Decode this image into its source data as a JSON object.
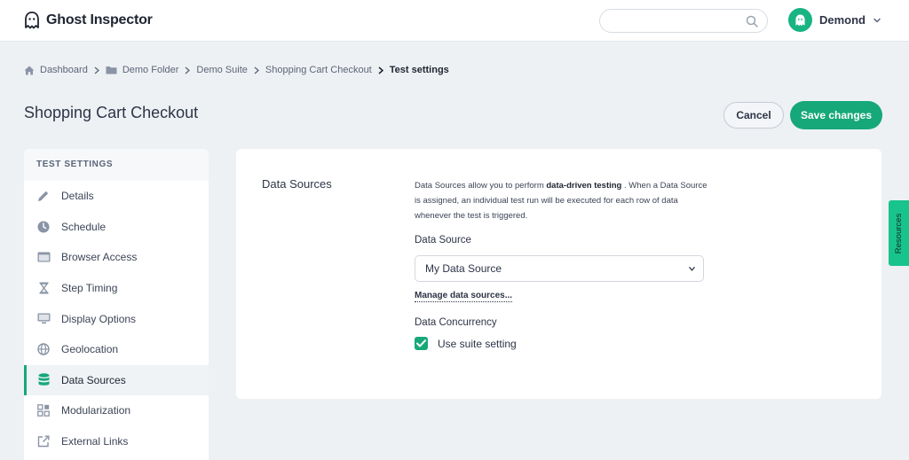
{
  "app": {
    "name": "Ghost Inspector"
  },
  "search": {
    "placeholder": "",
    "value": ""
  },
  "user": {
    "name": "Demond"
  },
  "breadcrumb": {
    "items": [
      "Dashboard",
      "Demo Folder",
      "Demo Suite",
      "Shopping Cart Checkout"
    ],
    "current": "Test settings"
  },
  "page": {
    "title": "Shopping Cart Checkout"
  },
  "actions": {
    "cancel": "Cancel",
    "save": "Save changes"
  },
  "sidebar": {
    "header": "TEST SETTINGS",
    "items": [
      {
        "label": "Details",
        "icon": "pencil-icon"
      },
      {
        "label": "Schedule",
        "icon": "clock-icon"
      },
      {
        "label": "Browser Access",
        "icon": "browser-window-icon"
      },
      {
        "label": "Step Timing",
        "icon": "hourglass-icon"
      },
      {
        "label": "Display Options",
        "icon": "monitor-icon"
      },
      {
        "label": "Geolocation",
        "icon": "globe-icon"
      },
      {
        "label": "Data Sources",
        "icon": "database-icon",
        "active": true
      },
      {
        "label": "Modularization",
        "icon": "modules-icon"
      },
      {
        "label": "External Links",
        "icon": "external-link-icon"
      }
    ]
  },
  "data_sources": {
    "section_title": "Data Sources",
    "desc_pre": "Data Sources allow you to perform ",
    "desc_bold": "data-driven testing",
    "desc_post": " . When a Data Source is assigned, an individual test run will be executed for each row of data whenever the test is triggered.",
    "data_source_label": "Data Source",
    "data_source_value": "My Data Source",
    "manage_link": "Manage data sources...",
    "concurrency_label": "Data Concurrency",
    "use_suite_setting": "Use suite setting",
    "use_suite_checked": true
  },
  "resources_tab": "Resources",
  "colors": {
    "accent": "#16a878",
    "background": "#eef1f4",
    "text": "#2d3446"
  }
}
